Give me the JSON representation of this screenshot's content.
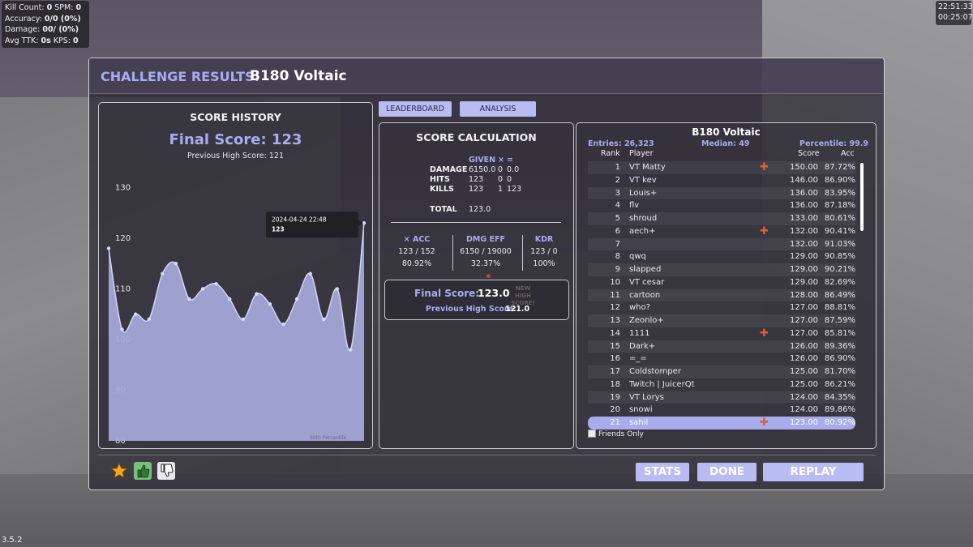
{
  "hud": {
    "kill_count_label": "Kill Count:",
    "kill_count": "0",
    "spm_label": "SPM:",
    "spm": "0",
    "accuracy_label": "Accuracy:",
    "accuracy": "0/0 (0%)",
    "damage_label": "Damage:",
    "damage": "00/ (0%)",
    "avg_ttk_label": "Avg TTK:",
    "avg_ttk": "0s",
    "kps_label": "KPS:",
    "kps": "0",
    "clock_time": "22:51:33",
    "session_time": "00:25:07"
  },
  "version": "3.5.2",
  "window": {
    "title_prefix": "CHALLENGE RESULTS:",
    "title_name": "B180 Voltaic"
  },
  "history": {
    "title": "SCORE HISTORY",
    "final_score": "Final Score: 123",
    "previous_high": "Previous High Score: 121",
    "tooltip_date": "2024-04-24 22:48",
    "tooltip_value": "123",
    "percentile_label": "90th Percentile"
  },
  "chart_data": {
    "type": "area",
    "title": "SCORE HISTORY",
    "xlabel": "",
    "ylabel": "",
    "y_ticks": [
      80,
      90,
      100,
      110,
      120,
      130
    ],
    "ylim": [
      80,
      132
    ],
    "values": [
      118,
      102,
      105,
      104,
      113,
      115,
      108,
      110,
      111,
      108,
      104,
      109,
      107,
      103,
      108,
      113,
      104,
      110,
      98,
      123
    ],
    "fill_color": "#a7aadb",
    "line_color": "#d2d4f8"
  },
  "tabs": {
    "leaderboard": "LEADERBOARD",
    "analysis": "ANALYSIS"
  },
  "calc": {
    "title": "SCORE CALCULATION",
    "head_given": "GIVEN",
    "head_x": "×",
    "head_eq": "=",
    "rows": [
      {
        "label": "DAMAGE",
        "given": "6150.0",
        "mult": "0",
        "result": "0.0"
      },
      {
        "label": "HITS",
        "given": "123",
        "mult": "0",
        "result": "0"
      },
      {
        "label": "KILLS",
        "given": "123",
        "mult": "1",
        "result": "123"
      }
    ],
    "total_label": "TOTAL",
    "total_value": "123.0",
    "stats": [
      {
        "head": "× ACC",
        "line1": "123 / 152",
        "line2": "80.92%"
      },
      {
        "head": "DMG EFF",
        "line1": "6150 / 19000",
        "line2": "32.37%"
      },
      {
        "head": "KDR",
        "line1": "123 / 0",
        "line2": "100%"
      }
    ],
    "final_label": "Final Score:",
    "final_value": "123.0",
    "prev_label": "Previous High Score:",
    "prev_value": "121.0",
    "new_high": "NEW HIGH SCORE!"
  },
  "leaderboard": {
    "title": "B180 Voltaic",
    "entries": "Entries: 26,323",
    "median": "Median: 49",
    "percentile": "Percentile: 99.9",
    "col_rank": "Rank",
    "col_player": "Player",
    "col_score": "Score",
    "col_acc": "Acc",
    "rows": [
      {
        "rank": "1",
        "player": "VT Matty",
        "plus": "✚",
        "score": "150.00",
        "acc": "87.72%"
      },
      {
        "rank": "2",
        "player": "VT kev",
        "plus": "",
        "score": "146.00",
        "acc": "86.90%"
      },
      {
        "rank": "3",
        "player": "Louis+",
        "plus": "",
        "score": "136.00",
        "acc": "83.95%"
      },
      {
        "rank": "4",
        "player": "flv",
        "plus": "",
        "score": "136.00",
        "acc": "87.18%"
      },
      {
        "rank": "5",
        "player": "shroud",
        "plus": "",
        "score": "133.00",
        "acc": "80.61%"
      },
      {
        "rank": "6",
        "player": "aech+",
        "plus": "✚",
        "score": "132.00",
        "acc": "90.41%"
      },
      {
        "rank": "7",
        "player": "",
        "plus": "",
        "score": "132.00",
        "acc": "91.03%"
      },
      {
        "rank": "8",
        "player": "qwq",
        "plus": "",
        "score": "129.00",
        "acc": "90.85%"
      },
      {
        "rank": "9",
        "player": "slapped",
        "plus": "",
        "score": "129.00",
        "acc": "90.21%"
      },
      {
        "rank": "10",
        "player": "VT cesar",
        "plus": "",
        "score": "129.00",
        "acc": "82.69%"
      },
      {
        "rank": "11",
        "player": "cartoon",
        "plus": "",
        "score": "128.00",
        "acc": "86.49%"
      },
      {
        "rank": "12",
        "player": "who?",
        "plus": "",
        "score": "127.00",
        "acc": "88.81%"
      },
      {
        "rank": "13",
        "player": "Zeonlo+",
        "plus": "",
        "score": "127.00",
        "acc": "87.59%"
      },
      {
        "rank": "14",
        "player": "1111",
        "plus": "✚",
        "score": "127.00",
        "acc": "85.81%"
      },
      {
        "rank": "15",
        "player": "Dark+",
        "plus": "",
        "score": "126.00",
        "acc": "89.36%"
      },
      {
        "rank": "16",
        "player": "=_=",
        "plus": "",
        "score": "126.00",
        "acc": "86.90%"
      },
      {
        "rank": "17",
        "player": "Coldstomper",
        "plus": "",
        "score": "125.00",
        "acc": "81.70%"
      },
      {
        "rank": "18",
        "player": "Twitch | JuicerQt",
        "plus": "",
        "score": "125.00",
        "acc": "86.21%"
      },
      {
        "rank": "19",
        "player": "VT Lorys",
        "plus": "",
        "score": "124.00",
        "acc": "84.35%"
      },
      {
        "rank": "20",
        "player": "snowi",
        "plus": "",
        "score": "124.00",
        "acc": "89.86%"
      },
      {
        "rank": "21",
        "player": "sahil",
        "plus": "✚",
        "score": "123.00",
        "acc": "80.92%",
        "self": true
      }
    ],
    "friends_only": "Friends Only"
  },
  "buttons": {
    "stats": "STATS",
    "done": "DONE",
    "replay": "REPLAY"
  },
  "icons": {
    "favorite": "star-icon",
    "like": "thumbs-up-icon",
    "dislike": "thumbs-down-icon"
  }
}
